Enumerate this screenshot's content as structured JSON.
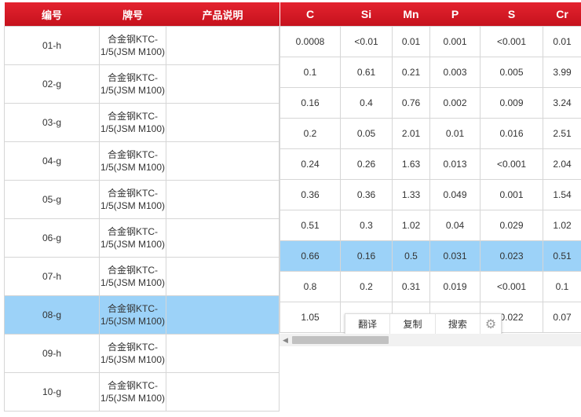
{
  "left_table": {
    "headers": [
      "编号",
      "牌号",
      "产品说明"
    ],
    "rows": [
      {
        "id": "01-h",
        "brand": "合金钢KTC-1/5(JSM M100)",
        "desc": ""
      },
      {
        "id": "02-g",
        "brand": "合金钢KTC-1/5(JSM M100)",
        "desc": ""
      },
      {
        "id": "03-g",
        "brand": "合金钢KTC-1/5(JSM M100)",
        "desc": ""
      },
      {
        "id": "04-g",
        "brand": "合金钢KTC-1/5(JSM M100)",
        "desc": ""
      },
      {
        "id": "05-g",
        "brand": "合金钢KTC-1/5(JSM M100)",
        "desc": ""
      },
      {
        "id": "06-g",
        "brand": "合金钢KTC-1/5(JSM M100)",
        "desc": ""
      },
      {
        "id": "07-h",
        "brand": "合金钢KTC-1/5(JSM M100)",
        "desc": ""
      },
      {
        "id": "08-g",
        "brand": "合金钢KTC-1/5(JSM M100)",
        "desc": ""
      },
      {
        "id": "09-h",
        "brand": "合金钢KTC-1/5(JSM M100)",
        "desc": ""
      },
      {
        "id": "10-g",
        "brand": "合金钢KTC-1/5(JSM M100)",
        "desc": ""
      }
    ],
    "selected_index": 7
  },
  "right_table": {
    "headers": [
      "C",
      "Si",
      "Mn",
      "P",
      "S",
      "Cr"
    ],
    "rows": [
      [
        "0.0008",
        "<0.01",
        "0.01",
        "0.001",
        "<0.001",
        "0.01"
      ],
      [
        "0.1",
        "0.61",
        "0.21",
        "0.003",
        "0.005",
        "3.99"
      ],
      [
        "0.16",
        "0.4",
        "0.76",
        "0.002",
        "0.009",
        "3.24"
      ],
      [
        "0.2",
        "0.05",
        "2.01",
        "0.01",
        "0.016",
        "2.51"
      ],
      [
        "0.24",
        "0.26",
        "1.63",
        "0.013",
        "<0.001",
        "2.04"
      ],
      [
        "0.36",
        "0.36",
        "1.33",
        "0.049",
        "0.001",
        "1.54"
      ],
      [
        "0.51",
        "0.3",
        "1.02",
        "0.04",
        "0.029",
        "1.02"
      ],
      [
        "0.66",
        "0.16",
        "0.5",
        "0.031",
        "0.023",
        "0.51"
      ],
      [
        "0.8",
        "0.2",
        "0.31",
        "0.019",
        "<0.001",
        "0.1"
      ],
      [
        "1.05",
        "",
        "",
        "",
        "0.022",
        "0.07"
      ]
    ],
    "selected_index": 7
  },
  "toolbar": {
    "translate": "翻译",
    "copy": "复制",
    "search": "搜索",
    "settings_icon": "gear-icon"
  },
  "colors": {
    "header_red": "#d61a25",
    "selected_blue": "#9cd2f8"
  }
}
